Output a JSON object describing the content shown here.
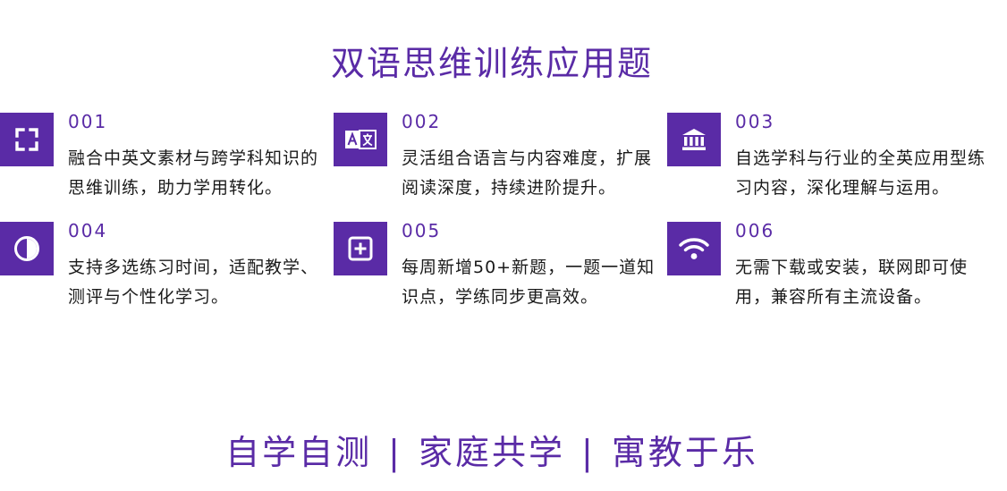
{
  "title": "双语思维训练应用题",
  "colors": {
    "accent": "#5a2ba6",
    "text": "#1a1a1a",
    "background": "#ffffff"
  },
  "features": [
    {
      "number": "001",
      "icon": "fullscreen-icon",
      "desc": "融合中英文素材与跨学科知识的思维训练，助力学用转化。"
    },
    {
      "number": "002",
      "icon": "translate-icon",
      "desc": "灵活组合语言与内容难度，扩展阅读深度，持续进阶提升。"
    },
    {
      "number": "003",
      "icon": "bank-icon",
      "desc": "自选学科与行业的全英应用型练习内容，深化理解与运用。"
    },
    {
      "number": "004",
      "icon": "contrast-icon",
      "desc": "支持多选练习时间，适配教学、测评与个性化学习。"
    },
    {
      "number": "005",
      "icon": "plus-box-icon",
      "desc": "每周新增50+新题，一题一道知识点，学练同步更高效。"
    },
    {
      "number": "006",
      "icon": "wifi-icon",
      "desc": "无需下载或安装，联网即可使用，兼容所有主流设备。"
    }
  ],
  "slogan": {
    "parts": [
      "自学自测",
      "家庭共学",
      "寓教于乐"
    ],
    "separator": "|"
  }
}
